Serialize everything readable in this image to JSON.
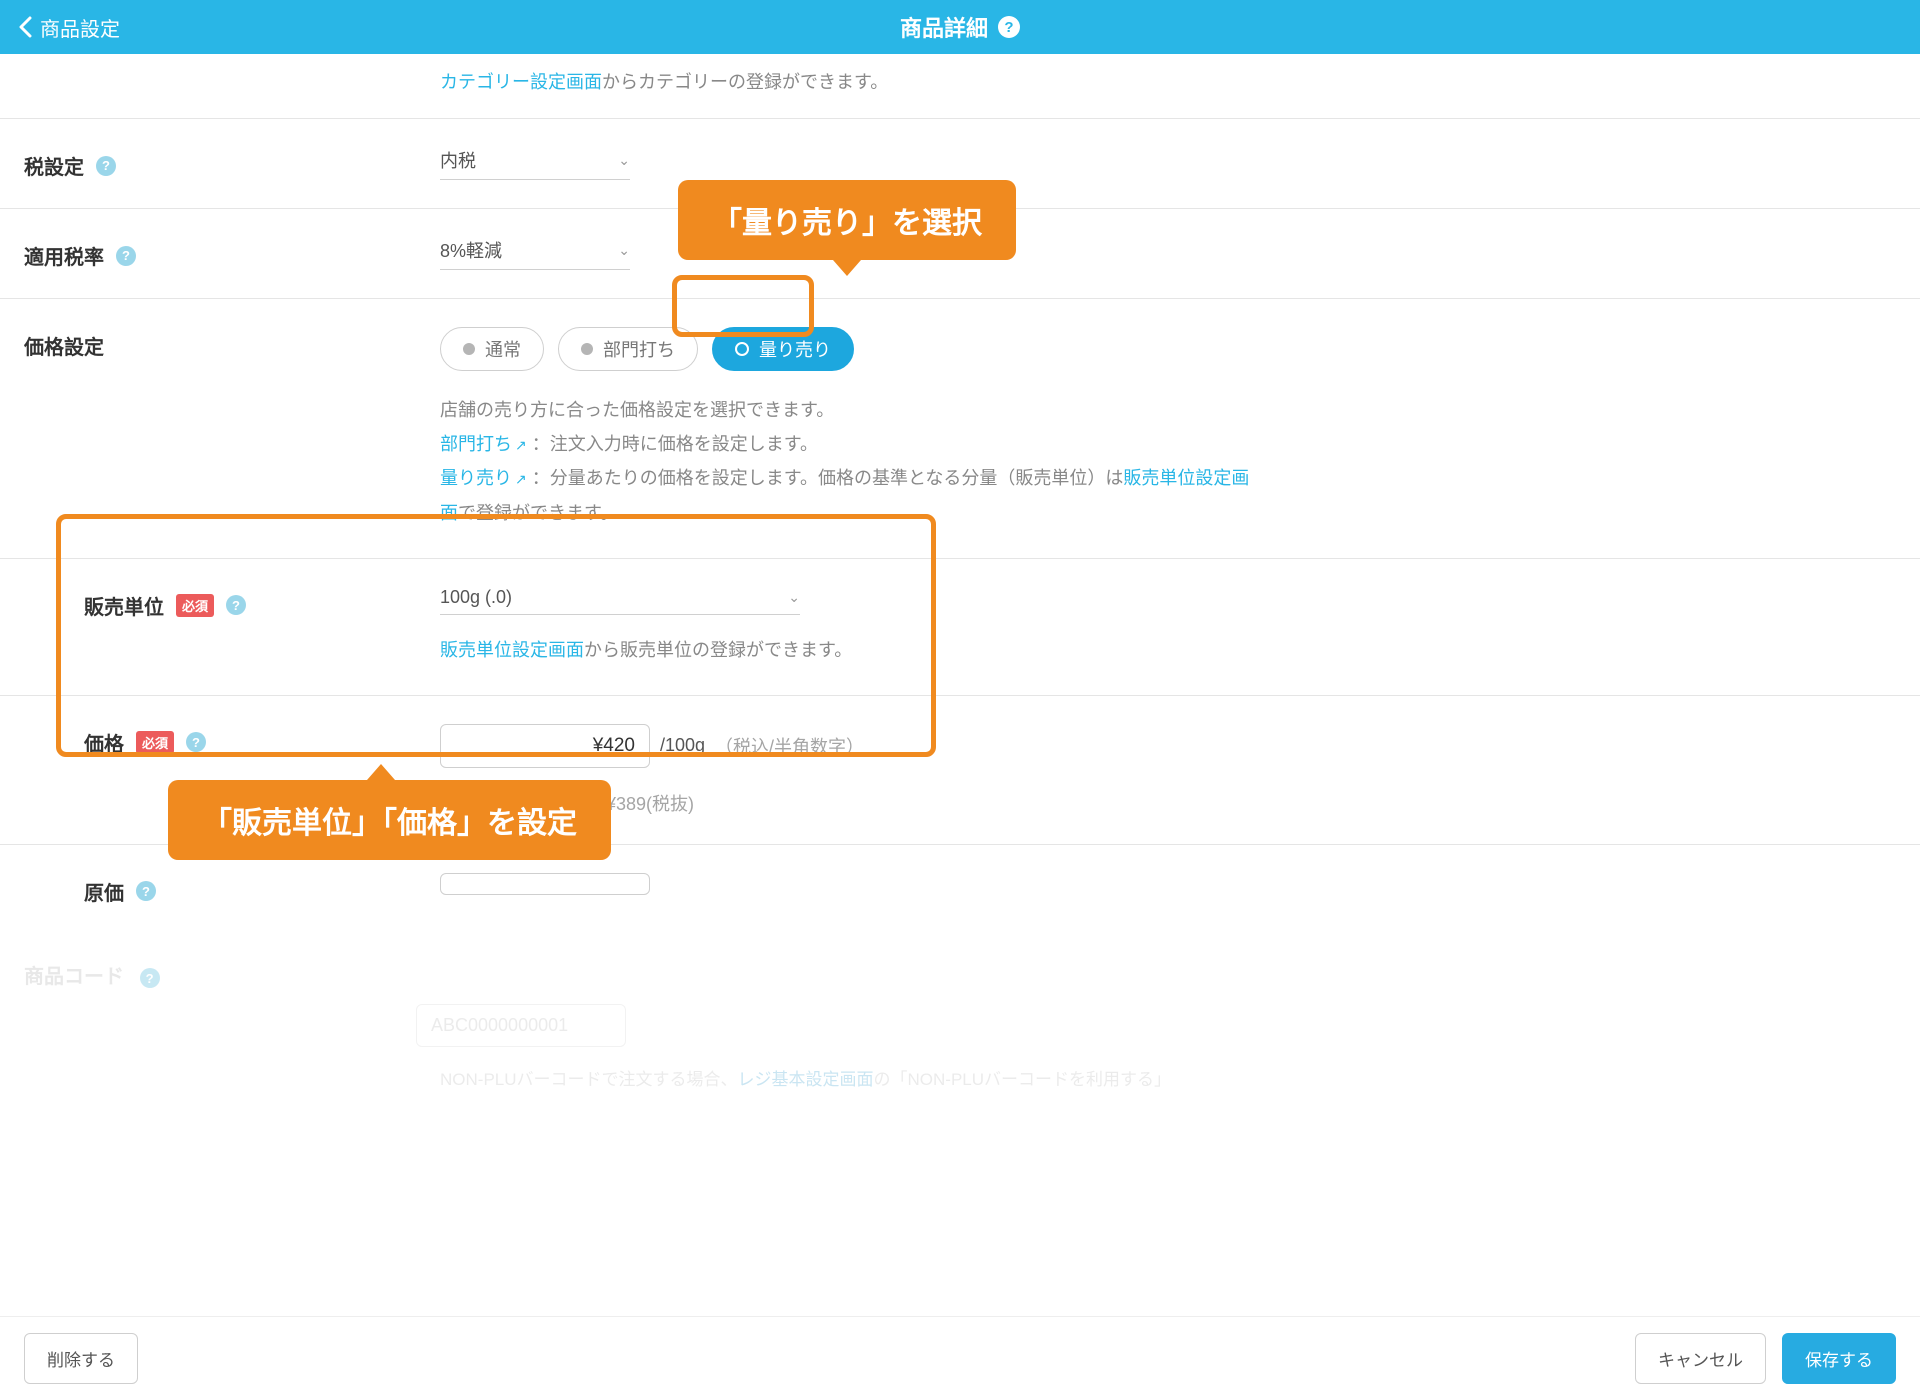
{
  "header": {
    "back": "商品設定",
    "title": "商品詳細"
  },
  "topNote": {
    "link": "カテゴリー設定画面",
    "rest": "からカテゴリーの登録ができます。"
  },
  "tax": {
    "label": "税設定",
    "value": "内税"
  },
  "rate": {
    "label": "適用税率",
    "value": "8%軽減"
  },
  "priceType": {
    "label": "価格設定",
    "opts": {
      "normal": "通常",
      "dept": "部門打ち",
      "weigh": "量り売り"
    },
    "desc1": "店舗の売り方に合った価格設定を選択できます。",
    "deptLink": "部門打ち",
    "deptDesc": "：注文入力時に価格を設定します。",
    "weighLink": "量り売り",
    "weighDesc1": "：分量あたりの価格を設定します。価格の基準となる分量（販売単位）は",
    "weighDesc2": "で登録ができます。",
    "unitSettingsLink": "販売単位設定画面"
  },
  "saleUnit": {
    "label": "販売単位",
    "required": "必須",
    "value": "100g (.0)",
    "noteLink": "販売単位設定画面",
    "noteRest": "から販売単位の登録ができます。"
  },
  "price": {
    "label": "価格",
    "required": "必須",
    "value": "¥420",
    "per": "/100g",
    "hint": "（税込/半角数字）",
    "excl": "¥389(税抜)"
  },
  "cost": {
    "label": "原価"
  },
  "callouts": {
    "top": "「量り売り」を選択",
    "bottom": "「販売単位」「価格」を設定"
  },
  "ghost": {
    "label": "商品コード",
    "placeholder": "ABC0000000001",
    "note1": "NON-PLUバーコードで注文する場合、",
    "noteLink": "レジ基本設定画面",
    "note2": "の「NON-PLUバーコードを利用する」"
  },
  "footer": {
    "delete": "削除する",
    "cancel": "キャンセル",
    "save": "保存する"
  }
}
